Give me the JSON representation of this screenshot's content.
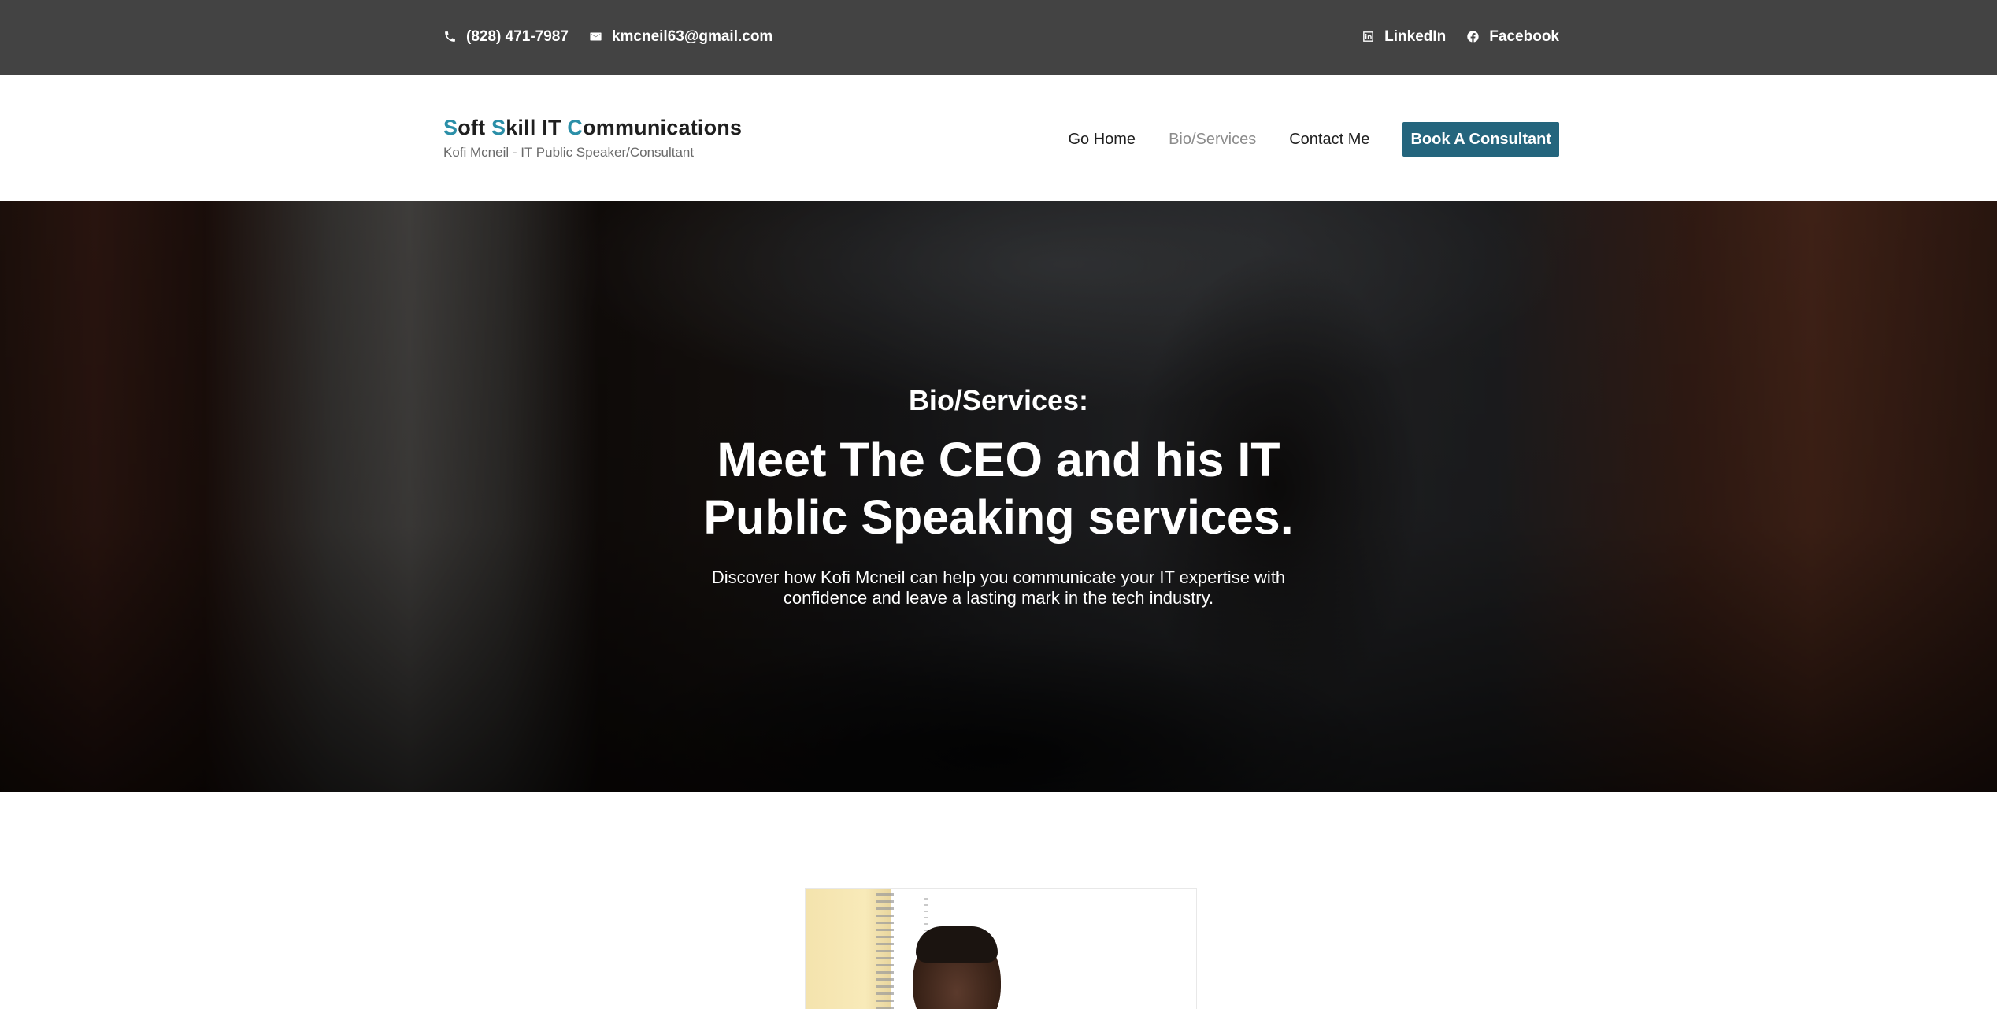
{
  "topbar": {
    "phone": {
      "icon": "phone-icon",
      "text": "(828) 471-7987"
    },
    "email": {
      "icon": "mail-icon",
      "text": "kmcneil63@gmail.com"
    },
    "linkedin": {
      "icon": "linkedin-icon",
      "text": "LinkedIn"
    },
    "facebook": {
      "icon": "facebook-icon",
      "text": "Facebook"
    },
    "background": "#434343"
  },
  "header": {
    "brand": {
      "word1_initial": "S",
      "word1_rest": "oft",
      "word2_initial": "S",
      "word2_rest": "kill",
      "word3": "IT",
      "word4_initial": "C",
      "word4_rest": "ommunications",
      "subtitle": "Kofi Mcneil - IT Public Speaker/Consultant",
      "accent_color": "#2b8fa8"
    },
    "nav": {
      "items": [
        {
          "label": "Go Home",
          "active": false
        },
        {
          "label": "Bio/Services",
          "active": true
        },
        {
          "label": "Contact Me",
          "active": false
        }
      ],
      "cta": "Book A Consultant",
      "cta_color": "#24657d"
    }
  },
  "hero": {
    "eyebrow": "Bio/Services:",
    "headline": "Meet The CEO and his IT Public Speaking services.",
    "description": "Discover how Kofi Mcneil can help you communicate your IT expertise with confidence and leave a lasting mark in the tech industry."
  },
  "bio": {
    "photo": "ceo-portrait-image"
  }
}
